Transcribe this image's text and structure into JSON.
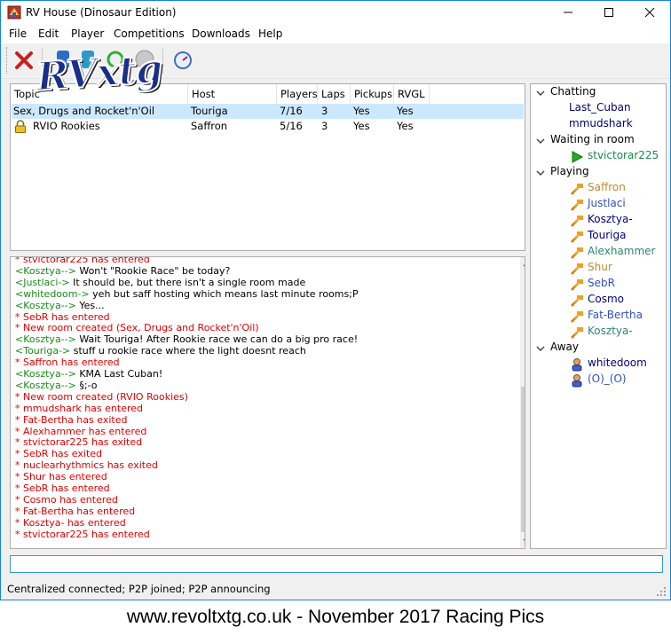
{
  "window": {
    "title": "RV House (Dinosaur Edition)"
  },
  "menu": {
    "items": [
      "File",
      "Edit",
      "Player",
      "Competitions",
      "Downloads",
      "Help"
    ]
  },
  "toolbar": {
    "logo_text": "RVxtg"
  },
  "rooms": {
    "columns": [
      "Topic",
      "Host",
      "Players",
      "Laps",
      "Pickups",
      "RVGL"
    ],
    "rows": [
      {
        "topic": "Sex, Drugs and Rocket'n'Oil",
        "host": "Touriga",
        "players": "7/16",
        "laps": "3",
        "pickups": "Yes",
        "rvgl": "Yes",
        "selected": true,
        "locked": false
      },
      {
        "topic": "RVIO Rookies",
        "host": "Saffron",
        "players": "5/16",
        "laps": "3",
        "pickups": "Yes",
        "rvgl": "Yes",
        "selected": false,
        "locked": true
      }
    ]
  },
  "chat": {
    "messages": [
      {
        "kind": "event",
        "text": "* stvictorar225 has entered"
      },
      {
        "kind": "msg",
        "user": "Kosztya-",
        "text": " Won't \"Rookie Race\" be today?"
      },
      {
        "kind": "msg",
        "user": "Justlaci",
        "text": " It should be, but there isn't a single room made"
      },
      {
        "kind": "msg",
        "user": "whitedoom",
        "text": " yeh but saff hosting which means last minute rooms;P"
      },
      {
        "kind": "msg",
        "user": "Kosztya-",
        "text": " Yes..."
      },
      {
        "kind": "event",
        "text": "* SebR has entered"
      },
      {
        "kind": "event",
        "text": "* New room created (Sex, Drugs and Rocket'n'Oil)"
      },
      {
        "kind": "msg",
        "user": "Kosztya-",
        "text": " Wait Touriga! After Rookie race we can do a big pro race!"
      },
      {
        "kind": "msg",
        "user": "Touriga",
        "text": " stuff u rookie race where the light doesnt reach"
      },
      {
        "kind": "event",
        "text": "* Saffron has entered"
      },
      {
        "kind": "msg",
        "user": "Kosztya-",
        "text": " KMA Last Cuban!"
      },
      {
        "kind": "msg",
        "user": "Kosztya-",
        "text": " §;-o"
      },
      {
        "kind": "event",
        "text": "* New room created (RVIO Rookies)"
      },
      {
        "kind": "event",
        "text": "* mmudshark has entered"
      },
      {
        "kind": "event",
        "text": "* Fat-Bertha has exited"
      },
      {
        "kind": "event",
        "text": "* Alexhammer has entered"
      },
      {
        "kind": "event",
        "text": "* stvictorar225 has exited"
      },
      {
        "kind": "event",
        "text": "* SebR has exited"
      },
      {
        "kind": "event",
        "text": "* nuclearhythmics has exited"
      },
      {
        "kind": "event",
        "text": "* Shur has entered"
      },
      {
        "kind": "event",
        "text": "* SebR has entered"
      },
      {
        "kind": "event",
        "text": "* Cosmo has entered"
      },
      {
        "kind": "event",
        "text": "* Fat-Bertha has entered"
      },
      {
        "kind": "event",
        "text": "* Kosztya- has entered"
      },
      {
        "kind": "event",
        "text": "* stvictorar225 has entered"
      }
    ],
    "input_value": ""
  },
  "users": {
    "groups": [
      {
        "label": "Chatting",
        "users": [
          {
            "name": "Last_Cuban",
            "color": "#00007f",
            "icon": "none"
          },
          {
            "name": "mmudshark",
            "color": "#00007f",
            "icon": "none"
          }
        ]
      },
      {
        "label": "Waiting in room",
        "users": [
          {
            "name": "stvictorar225",
            "color": "#1a8a4a",
            "icon": "play-icon"
          }
        ]
      },
      {
        "label": "Playing",
        "users": [
          {
            "name": "Saffron",
            "color": "#c08a30",
            "icon": "race-icon"
          },
          {
            "name": "Justlaci",
            "color": "#3050c0",
            "icon": "race-icon"
          },
          {
            "name": "Kosztya-",
            "color": "#00007f",
            "icon": "race-icon"
          },
          {
            "name": "Touriga",
            "color": "#00007f",
            "icon": "race-icon"
          },
          {
            "name": "Alexhammer",
            "color": "#2a8a6a",
            "icon": "race-icon"
          },
          {
            "name": "Shur",
            "color": "#c08a30",
            "icon": "race-icon"
          },
          {
            "name": "SebR",
            "color": "#3050c0",
            "icon": "race-icon"
          },
          {
            "name": "Cosmo",
            "color": "#00007f",
            "icon": "race-icon"
          },
          {
            "name": "Fat-Bertha",
            "color": "#3050c0",
            "icon": "race-icon"
          },
          {
            "name": "Kosztya-",
            "color": "#2a8a6a",
            "icon": "race-icon"
          }
        ]
      },
      {
        "label": "Away",
        "users": [
          {
            "name": "whitedoom",
            "color": "#00007f",
            "icon": "away-icon"
          },
          {
            "name": "(O)_(O)",
            "color": "#3050c0",
            "icon": "away-icon"
          }
        ]
      }
    ]
  },
  "status": {
    "text": "Centralized connected; P2P joined; P2P announcing"
  },
  "caption": {
    "text": "www.revoltxtg.co.uk - November 2017 Racing Pics"
  },
  "colors": {
    "accent": "#1683d8",
    "event": "#e00000",
    "username": "#1a8a1a",
    "selection": "#cce8ff"
  }
}
